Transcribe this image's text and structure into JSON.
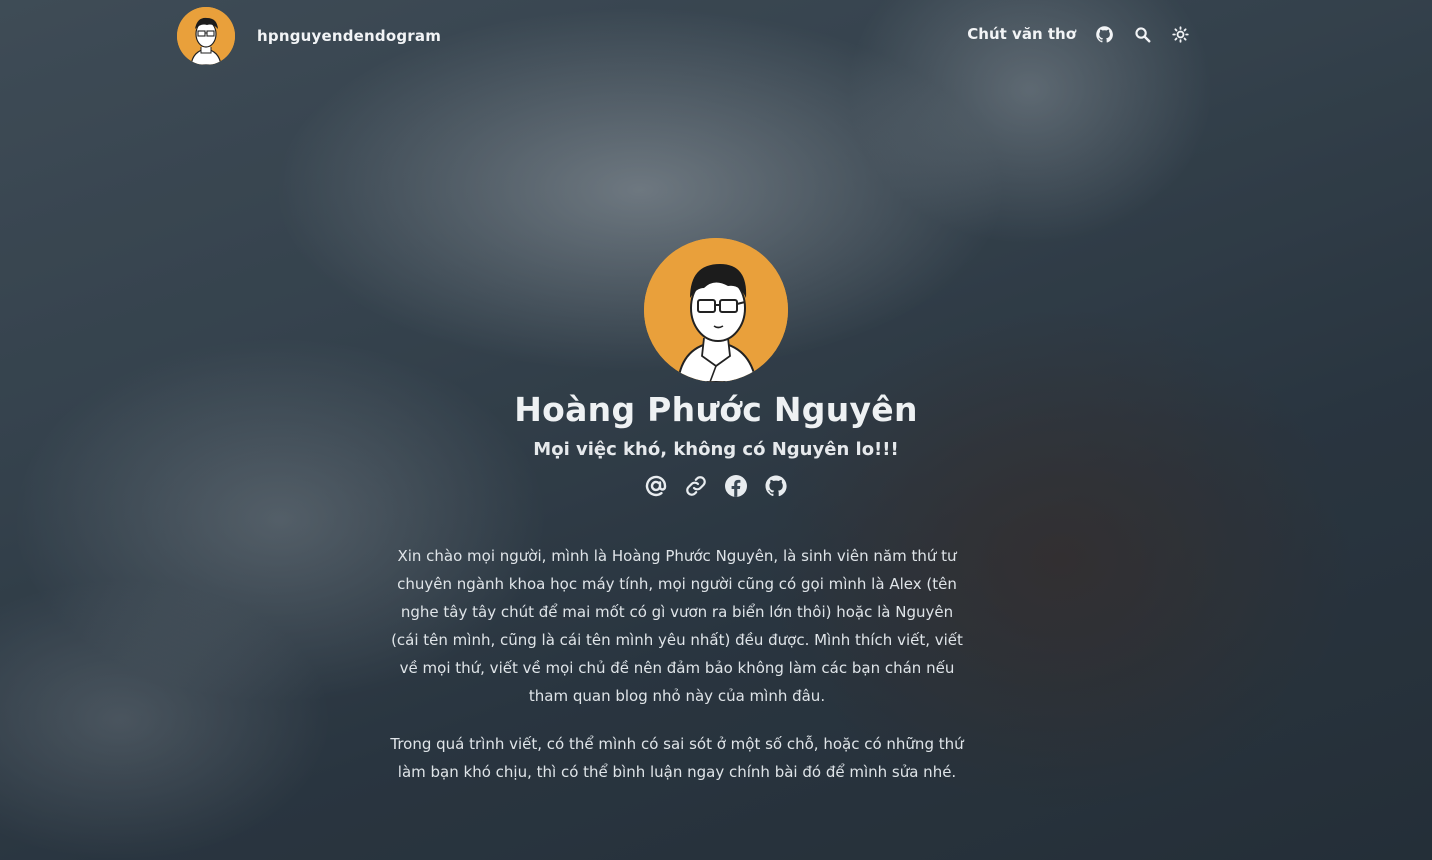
{
  "header": {
    "site_title": "hpnguyendendogram",
    "nav": {
      "poetry_label": "Chút văn thơ",
      "github_icon": "github-icon",
      "search_icon": "search-icon",
      "theme_icon": "sun-icon"
    }
  },
  "profile": {
    "name": "Hoàng Phước Nguyên",
    "tagline": "Mọi việc khó, không có Nguyên lo!!!",
    "socials": [
      "email-icon",
      "link-icon",
      "facebook-icon",
      "github-icon"
    ],
    "avatar_bg": "#e9a03b"
  },
  "bio": {
    "paragraph1": "Xin chào mọi người, mình là Hoàng Phước Nguyên, là sinh viên năm thứ tư chuyên ngành khoa học máy tính, mọi người cũng có gọi mình là Alex (tên nghe tây tây chút để mai mốt có gì vươn ra biển lớn thôi) hoặc là Nguyên (cái tên mình, cũng là cái tên mình yêu nhất) đều được. Mình thích viết, viết về mọi thứ, viết về mọi chủ đề nên đảm bảo không làm các bạn chán nếu tham quan blog nhỏ này của mình đâu.",
    "paragraph2": "Trong quá trình viết, có thể mình có sai sót ở một số chỗ, hoặc có những thứ làm bạn khó chịu, thì có thể bình luận ngay chính bài đó để mình sửa nhé."
  }
}
